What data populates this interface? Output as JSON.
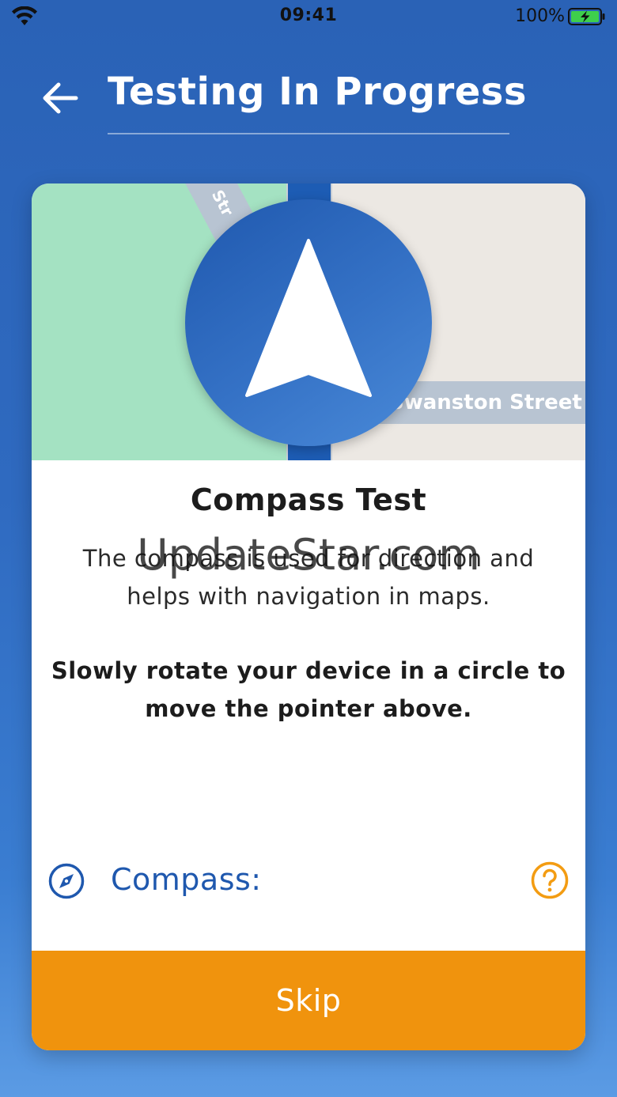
{
  "status_bar": {
    "time": "09:41",
    "battery_percent": "100%",
    "wifi_icon": "wifi-icon",
    "battery_icon": "battery-charging-icon"
  },
  "header": {
    "back_icon": "arrow-left-icon",
    "title": "Testing In Progress"
  },
  "map": {
    "diagonal_road_label": "Str",
    "street_label": "Swanston Street"
  },
  "card": {
    "test_title": "Compass Test",
    "description": "The compass is used for direction and helps with navigation in maps.",
    "instruction": "Slowly rotate your device in a circle to move the pointer above.",
    "compass_label": "Compass:",
    "compass_icon": "compass-icon",
    "help_icon": "question-circle-icon",
    "skip_label": "Skip"
  },
  "watermark": "UpdateStar.com",
  "colors": {
    "background": "#2f6ac0",
    "accent_blue": "#1f58ae",
    "skip_orange": "#f0930d",
    "help_orange": "#f39c12",
    "park_green": "#a4e2c2"
  }
}
